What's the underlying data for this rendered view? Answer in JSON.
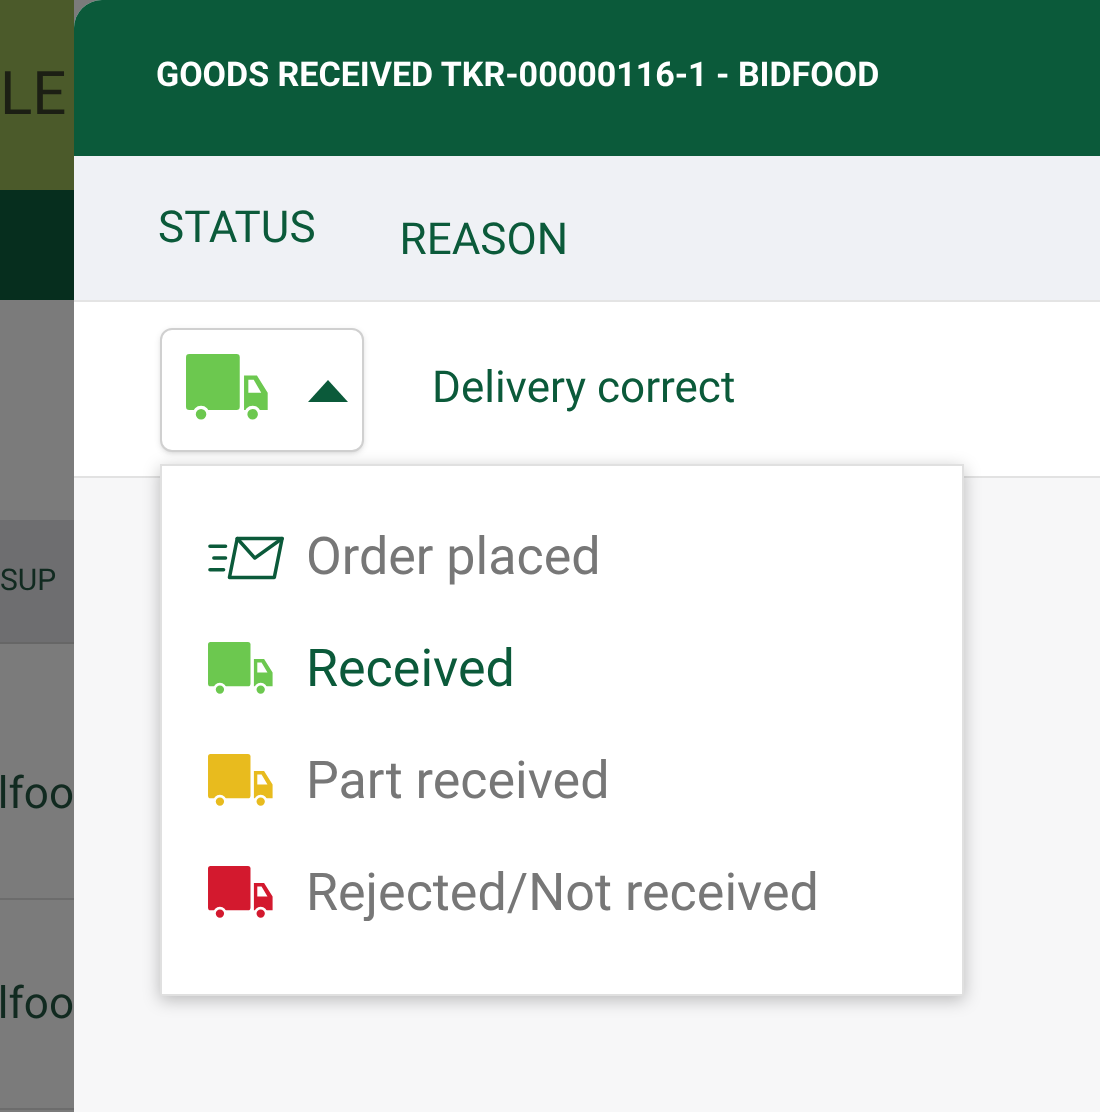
{
  "background": {
    "header_text": "LE",
    "column_header": "SUP",
    "cells": [
      "lfoo",
      "lfoo"
    ]
  },
  "dialog": {
    "title": "GOODS RECEIVED TKR-00000116-1 - BIDFOOD",
    "columns": [
      "STATUS",
      "REASON"
    ],
    "row": {
      "expanded": true,
      "reason": "Delivery correct"
    },
    "menu": [
      {
        "kind": "envelope",
        "label": "Order placed",
        "selected": false
      },
      {
        "kind": "truck",
        "label": "Received",
        "color": "#6cc84f",
        "selected": true
      },
      {
        "kind": "truck",
        "label": "Part received",
        "color": "#e8bb1e",
        "selected": false
      },
      {
        "kind": "truck",
        "label": "Rejected/Not received",
        "color": "#d3192e",
        "selected": false
      }
    ]
  }
}
